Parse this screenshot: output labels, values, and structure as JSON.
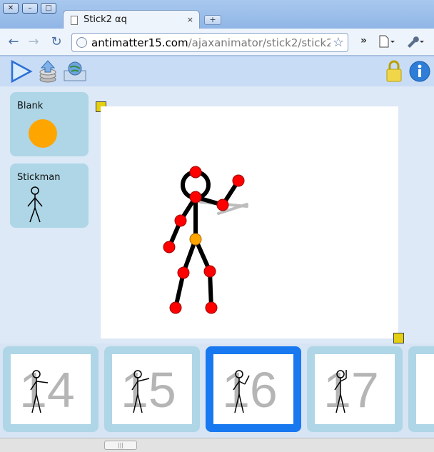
{
  "browser": {
    "tab_title": "Stick2 αq",
    "url_domain": "antimatter15.com",
    "url_path": "/ajaxanimator/stick2/stick2.htm",
    "new_tab_symbol": "+",
    "tab_close_symbol": "×"
  },
  "window_controls": {
    "close": "✕",
    "minimize": "–",
    "maximize": "□"
  },
  "toolbar_icons": [
    "back-icon",
    "forward-icon",
    "reload-icon",
    "star-icon",
    "overflow-icon",
    "page-menu-icon",
    "wrench-menu-icon"
  ],
  "app": {
    "icons": [
      "play-icon",
      "export-icon",
      "publish-icon",
      "lock-icon",
      "info-icon"
    ],
    "library": [
      {
        "label": "Blank"
      },
      {
        "label": "Stickman"
      }
    ],
    "accent_orange": "#ffa500",
    "joint_red": "#ff0000",
    "selected_frame_color": "#1878f0"
  },
  "timeline": {
    "frames": [
      {
        "number": "14",
        "selected": false
      },
      {
        "number": "15",
        "selected": false
      },
      {
        "number": "16",
        "selected": true
      },
      {
        "number": "17",
        "selected": false
      }
    ]
  },
  "scrollbar": {
    "thumb_grip": "|||"
  }
}
